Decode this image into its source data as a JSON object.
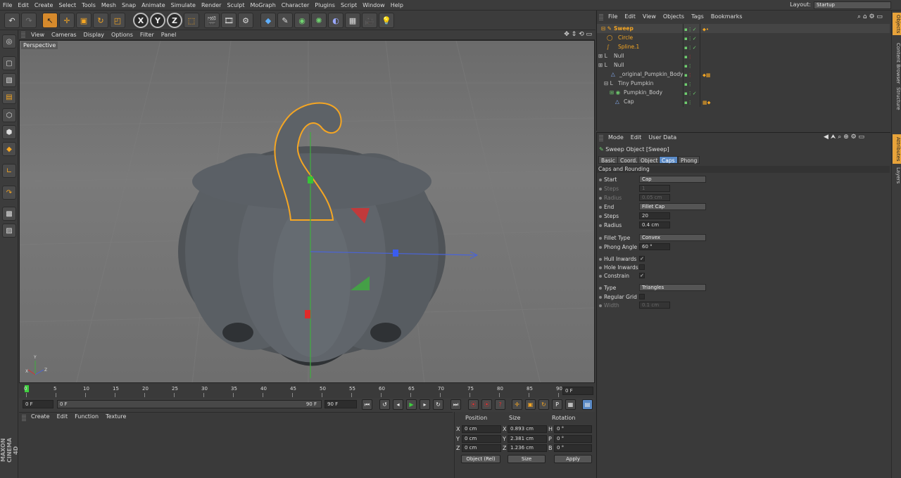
{
  "menubar": {
    "items": [
      "File",
      "Edit",
      "Create",
      "Select",
      "Tools",
      "Mesh",
      "Snap",
      "Animate",
      "Simulate",
      "Render",
      "Sculpt",
      "MoGraph",
      "Character",
      "Plugins",
      "Script",
      "Window",
      "Help"
    ],
    "layout_label": "Layout:",
    "layout_value": "Startup"
  },
  "viewport": {
    "menu": [
      "View",
      "Cameras",
      "Display",
      "Options",
      "Filter",
      "Panel"
    ],
    "label": "Perspective",
    "axes": {
      "y": "Y",
      "x": "X",
      "z": "Z"
    }
  },
  "timeline": {
    "ticks": [
      "0",
      "5",
      "10",
      "15",
      "20",
      "25",
      "30",
      "35",
      "40",
      "45",
      "50",
      "55",
      "60",
      "65",
      "70",
      "75",
      "80",
      "85",
      "90"
    ],
    "current_frame": "0 F"
  },
  "transport": {
    "start_field": "0 F",
    "slider_start": "0 F",
    "slider_end": "90 F",
    "end_field": "90 F"
  },
  "material": {
    "menu": [
      "Create",
      "Edit",
      "Function",
      "Texture"
    ]
  },
  "brand": {
    "name": "MAXON CINEMA 4D"
  },
  "coords": {
    "headers": {
      "position": "Position",
      "size": "Size",
      "rotation": "Rotation"
    },
    "rows": [
      {
        "axis": "X",
        "pos": "0 cm",
        "size_axis": "X",
        "size": "0.893 cm",
        "rot_axis": "H",
        "rot": "0 °"
      },
      {
        "axis": "Y",
        "pos": "0 cm",
        "size_axis": "Y",
        "size": "2.381 cm",
        "rot_axis": "P",
        "rot": "0 °"
      },
      {
        "axis": "Z",
        "pos": "0 cm",
        "size_axis": "Z",
        "size": "1.236 cm",
        "rot_axis": "B",
        "rot": "0 °"
      }
    ],
    "mode_select": "Object (Rel)",
    "size_select": "Size",
    "apply": "Apply"
  },
  "objects": {
    "menu": [
      "File",
      "Edit",
      "View",
      "Objects",
      "Tags",
      "Bookmarks"
    ],
    "rows": [
      {
        "name": "Sweep"
      },
      {
        "name": "Circle"
      },
      {
        "name": "Spline.1"
      },
      {
        "name": "Null"
      },
      {
        "name": "Null"
      },
      {
        "name": "_original_Pumpkin_Body"
      },
      {
        "name": "Tiny Pumpkin"
      },
      {
        "name": "Pumpkin_Body"
      },
      {
        "name": "Cap"
      }
    ]
  },
  "attributes": {
    "menu": [
      "Mode",
      "Edit",
      "User Data"
    ],
    "title": "Sweep Object [Sweep]",
    "tabs": [
      "Basic",
      "Coord.",
      "Object",
      "Caps",
      "Phong"
    ],
    "active_tab": "Caps",
    "section": "Caps and Rounding",
    "props": {
      "start_label": "Start",
      "start_value": "Cap",
      "steps1_label": "Steps",
      "steps1_value": "1",
      "radius1_label": "Radius",
      "radius1_value": "0.05 cm",
      "end_label": "End",
      "end_value": "Fillet Cap",
      "steps2_label": "Steps",
      "steps2_value": "20",
      "radius2_label": "Radius",
      "radius2_value": "0.4 cm",
      "fillet_type_label": "Fillet Type",
      "fillet_type_value": "Convex",
      "phong_angle_label": "Phong Angle",
      "phong_angle_value": "60 °",
      "hull_inwards_label": "Hull Inwards",
      "hull_inwards_value": "✓",
      "hole_inwards_label": "Hole Inwards",
      "constrain_label": "Constrain",
      "constrain_value": "✓",
      "type_label": "Type",
      "type_value": "Triangles",
      "regular_grid_label": "Regular Grid",
      "width_label": "Width",
      "width_value": "0.1 cm"
    }
  },
  "right_tabs": [
    "Objects",
    "Content Browser",
    "Structure",
    "Attributes",
    "Layers"
  ],
  "colors": {
    "accent": "#e8a33a",
    "selected_text": "#f5a623",
    "active_tab": "#5a8ac6"
  }
}
